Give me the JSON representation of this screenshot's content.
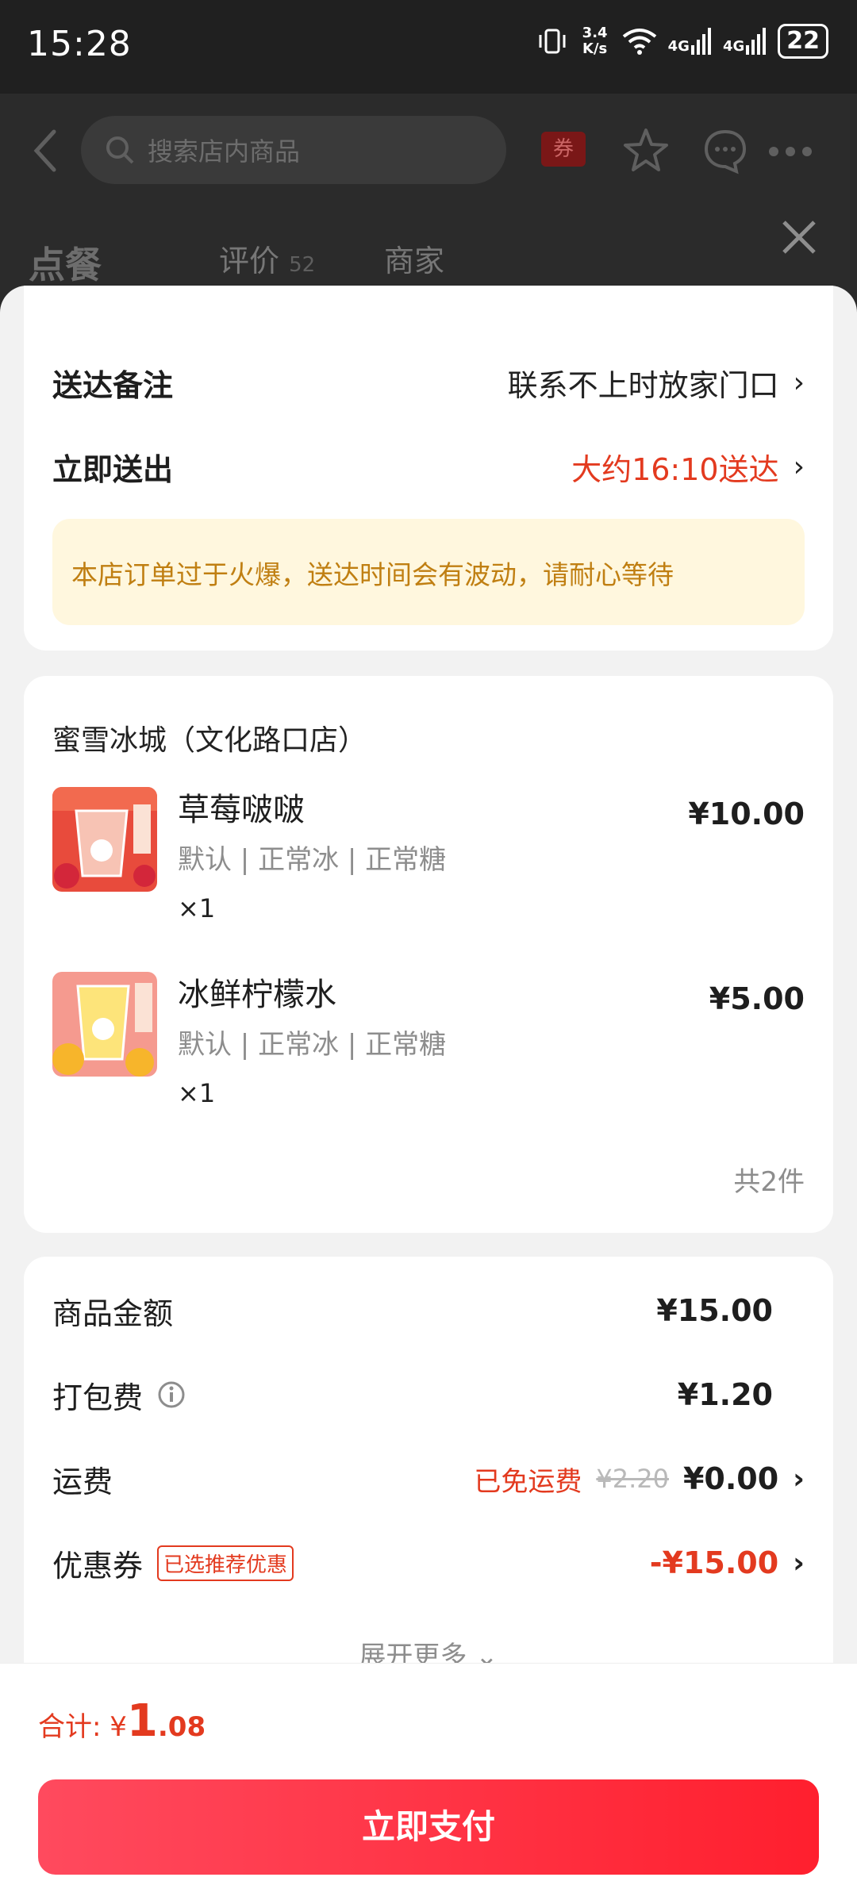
{
  "status_bar": {
    "time": "15:28",
    "net_speed": "3.4 K/s",
    "signal1": "4G",
    "signal2": "4G",
    "battery": "22"
  },
  "header": {
    "search_placeholder": "搜索店内商品",
    "coupon_label": "券",
    "tabs": [
      {
        "label": "点餐",
        "count": ""
      },
      {
        "label": "评价",
        "count": "52"
      },
      {
        "label": "商家",
        "count": ""
      }
    ]
  },
  "delivery": {
    "note_label": "送达备注",
    "note_value": "联系不上时放家门口",
    "time_label": "立即送出",
    "time_value": "大约16:10送达",
    "notice": "本店订单过于火爆，送达时间会有波动，请耐心等待"
  },
  "store": {
    "name": "蜜雪冰城（文化路口店）",
    "items": [
      {
        "name": "草莓啵啵",
        "spec": "默认 | 正常冰 | 正常糖",
        "qty": "×1",
        "price": "¥10.00"
      },
      {
        "name": "冰鲜柠檬水",
        "spec": "默认 | 正常冰 | 正常糖",
        "qty": "×1",
        "price": "¥5.00"
      }
    ],
    "count": "共2件"
  },
  "fees": {
    "goods_label": "商品金额",
    "goods_value": "¥15.00",
    "pack_label": "打包费",
    "pack_value": "¥1.20",
    "ship_label": "运费",
    "ship_free": "已免运费",
    "ship_orig": "¥2.20",
    "ship_value": "¥0.00",
    "coupon_label": "优惠券",
    "coupon_badge": "已选推荐优惠",
    "coupon_value": "-¥15.00",
    "expand": "展开更多"
  },
  "footer": {
    "total_label": "合计: ¥",
    "total_int": "1",
    "total_dec": ".08",
    "pay_button": "立即支付"
  },
  "colors": {
    "accent": "#e33a1f",
    "button": "#ff2a3c",
    "notice_bg": "#fff7de"
  }
}
